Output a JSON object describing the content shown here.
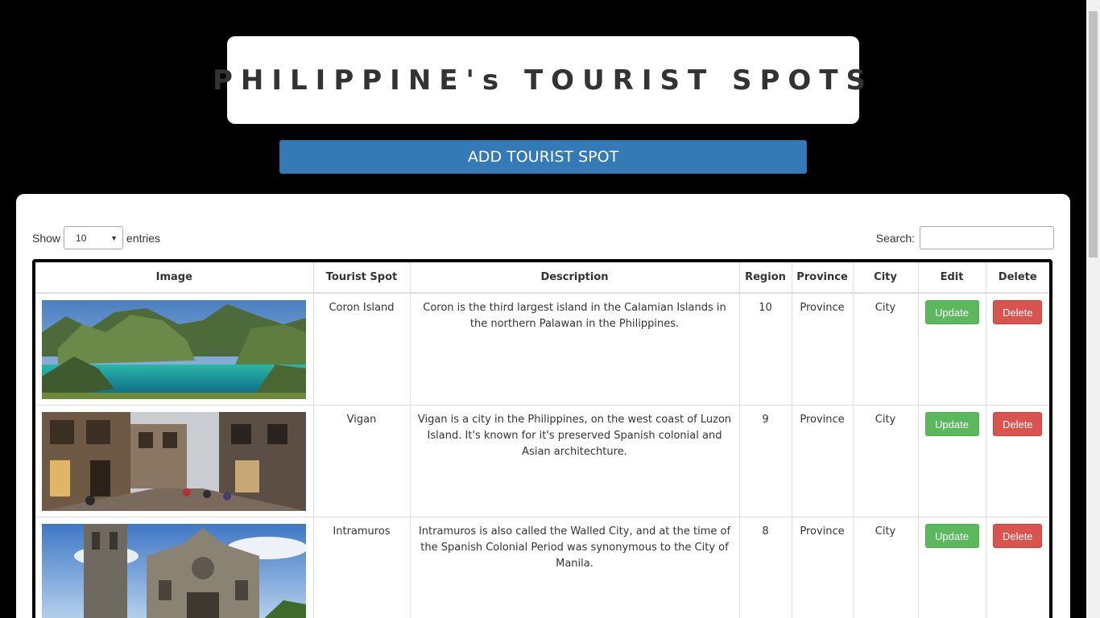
{
  "header": {
    "title": "PHILIPPINE's TOURIST SPOTS"
  },
  "toolbar": {
    "add_label": "ADD TOURIST SPOT"
  },
  "table_controls": {
    "show_label": "Show",
    "length_value": "10",
    "entries_label": "entries",
    "search_label": "Search:",
    "search_value": ""
  },
  "table": {
    "columns": [
      "Image",
      "Tourist Spot",
      "Description",
      "Region",
      "Province",
      "City",
      "Edit",
      "Delete"
    ],
    "rows": [
      {
        "spot": "Coron Island",
        "description": "Coron is the third largest island in the Calamian Islands in the northern Palawan in the Philippines.",
        "region": "10",
        "province": "Province",
        "city": "City",
        "edit": "Update",
        "delete": "Delete"
      },
      {
        "spot": "Vigan",
        "description": "Vigan is a city in the Philippines, on the west coast of Luzon Island. It's known for it's preserved Spanish colonial and Asian architechture.",
        "region": "9",
        "province": "Province",
        "city": "City",
        "edit": "Update",
        "delete": "Delete"
      },
      {
        "spot": "Intramuros",
        "description": "Intramuros is also called the Walled City, and at the time of the Spanish Colonial Period was synonymous to the City of Manila.",
        "region": "8",
        "province": "Province",
        "city": "City",
        "edit": "Update",
        "delete": "Delete"
      }
    ]
  },
  "colors": {
    "background": "#000000",
    "primary": "#337ab7",
    "success": "#5cb85c",
    "danger": "#d9534f"
  }
}
